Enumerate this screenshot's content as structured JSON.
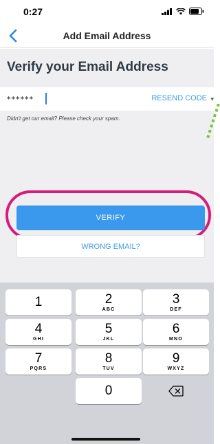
{
  "status_bar": {
    "time": "0:27",
    "icons": [
      "signal-icon",
      "wifi-icon",
      "battery-icon"
    ]
  },
  "nav": {
    "title": "Add Email Address",
    "back_icon": "chevron-left-icon"
  },
  "verify_section": {
    "heading": "Verify your Email Address",
    "code_value": "******",
    "resend_label": "RESEND CODE",
    "hint": "Didn't get our email? Please check your spam."
  },
  "actions": {
    "verify_label": "VERIFY",
    "wrong_email_label": "WRONG EMAIL?"
  },
  "keypad": {
    "keys": [
      {
        "num": "1",
        "letters": ""
      },
      {
        "num": "2",
        "letters": "ABC"
      },
      {
        "num": "3",
        "letters": "DEF"
      },
      {
        "num": "4",
        "letters": "GHI"
      },
      {
        "num": "5",
        "letters": "JKL"
      },
      {
        "num": "6",
        "letters": "MNO"
      },
      {
        "num": "7",
        "letters": "PQRS"
      },
      {
        "num": "8",
        "letters": "TUV"
      },
      {
        "num": "9",
        "letters": "WXYZ"
      },
      {
        "num": "0",
        "letters": ""
      }
    ],
    "delete_icon": "backspace-icon"
  },
  "colors": {
    "accent": "#3b99ed",
    "highlight": "#d81b7a",
    "decoration": "#7cc242"
  }
}
